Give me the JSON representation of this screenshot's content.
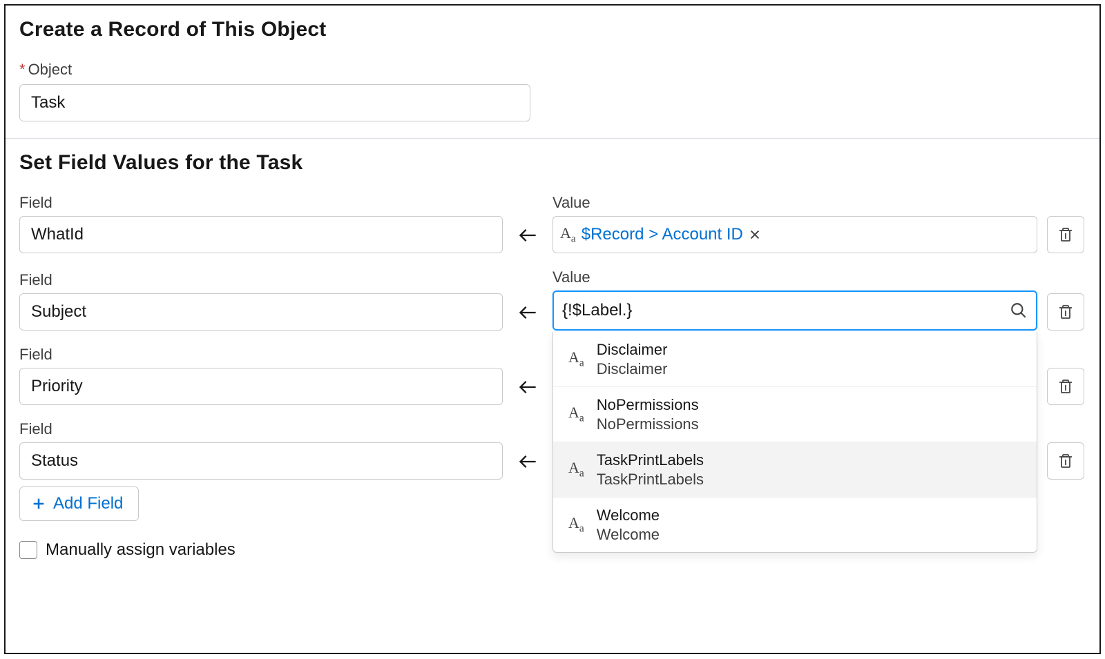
{
  "section1": {
    "heading": "Create a Record of This Object",
    "object_label": "Object",
    "object_value": "Task"
  },
  "section2": {
    "heading": "Set Field Values for the Task",
    "field_label": "Field",
    "value_label": "Value",
    "rows": [
      {
        "field": "WhatId",
        "value_type": "pill",
        "value_pill": "$Record > Account ID"
      },
      {
        "field": "Subject",
        "value_type": "search",
        "value_text": "{!$Label.}",
        "dropdown": [
          {
            "title": "Disclaimer",
            "sub": "Disclaimer",
            "highlighted": false
          },
          {
            "title": "NoPermissions",
            "sub": "NoPermissions",
            "highlighted": false
          },
          {
            "title": "TaskPrintLabels",
            "sub": "TaskPrintLabels",
            "highlighted": true
          },
          {
            "title": "Welcome",
            "sub": "Welcome",
            "highlighted": false
          }
        ]
      },
      {
        "field": "Priority",
        "value_type": "none"
      },
      {
        "field": "Status",
        "value_type": "none"
      }
    ],
    "add_field": "Add Field",
    "manual_assign": "Manually assign variables"
  }
}
